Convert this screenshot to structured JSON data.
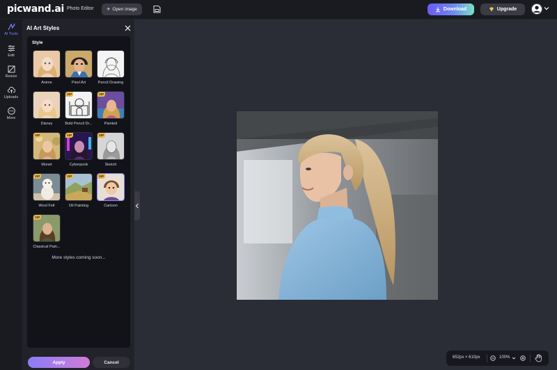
{
  "header": {
    "logo_main": "picwand",
    "logo_tld": ".ai",
    "nav_title": "Photo Editor",
    "open_image": "Open image",
    "download": "Download",
    "upgrade": "Upgrade"
  },
  "rail": {
    "items": [
      {
        "label": "AI Tools",
        "icon": "ai-tools-icon",
        "active": true
      },
      {
        "label": "Edit",
        "icon": "edit-icon"
      },
      {
        "label": "Resize",
        "icon": "resize-icon"
      },
      {
        "label": "Uploads",
        "icon": "upload-icon"
      },
      {
        "label": "More",
        "icon": "more-icon"
      }
    ]
  },
  "panel": {
    "title": "AI Art Styles",
    "style_header": "Style",
    "styles": [
      {
        "label": "Anime",
        "vip": false
      },
      {
        "label": "Pixel Art",
        "vip": false
      },
      {
        "label": "Pencil Drawing",
        "vip": false
      },
      {
        "label": "Disney",
        "vip": false
      },
      {
        "label": "Bold Pencil Dr...",
        "vip": true
      },
      {
        "label": "Painted",
        "vip": true
      },
      {
        "label": "Monet",
        "vip": true
      },
      {
        "label": "Cyberpunk",
        "vip": true
      },
      {
        "label": "Sketch",
        "vip": true
      },
      {
        "label": "Wool Felt",
        "vip": true
      },
      {
        "label": "Oil Painting",
        "vip": true
      },
      {
        "label": "Cartoon",
        "vip": true,
        "selected": true
      },
      {
        "label": "Classical Pain...",
        "vip": true
      }
    ],
    "vip_badge": "VIP",
    "coming_soon": "More styles coming soon...",
    "apply": "Apply",
    "cancel": "Cancel"
  },
  "status": {
    "dimensions": "652px × 610px",
    "zoom": "100%"
  },
  "colors": {
    "accent": "#6a5cf5",
    "background": "#2b2d36",
    "vip": "#e7b64d"
  }
}
